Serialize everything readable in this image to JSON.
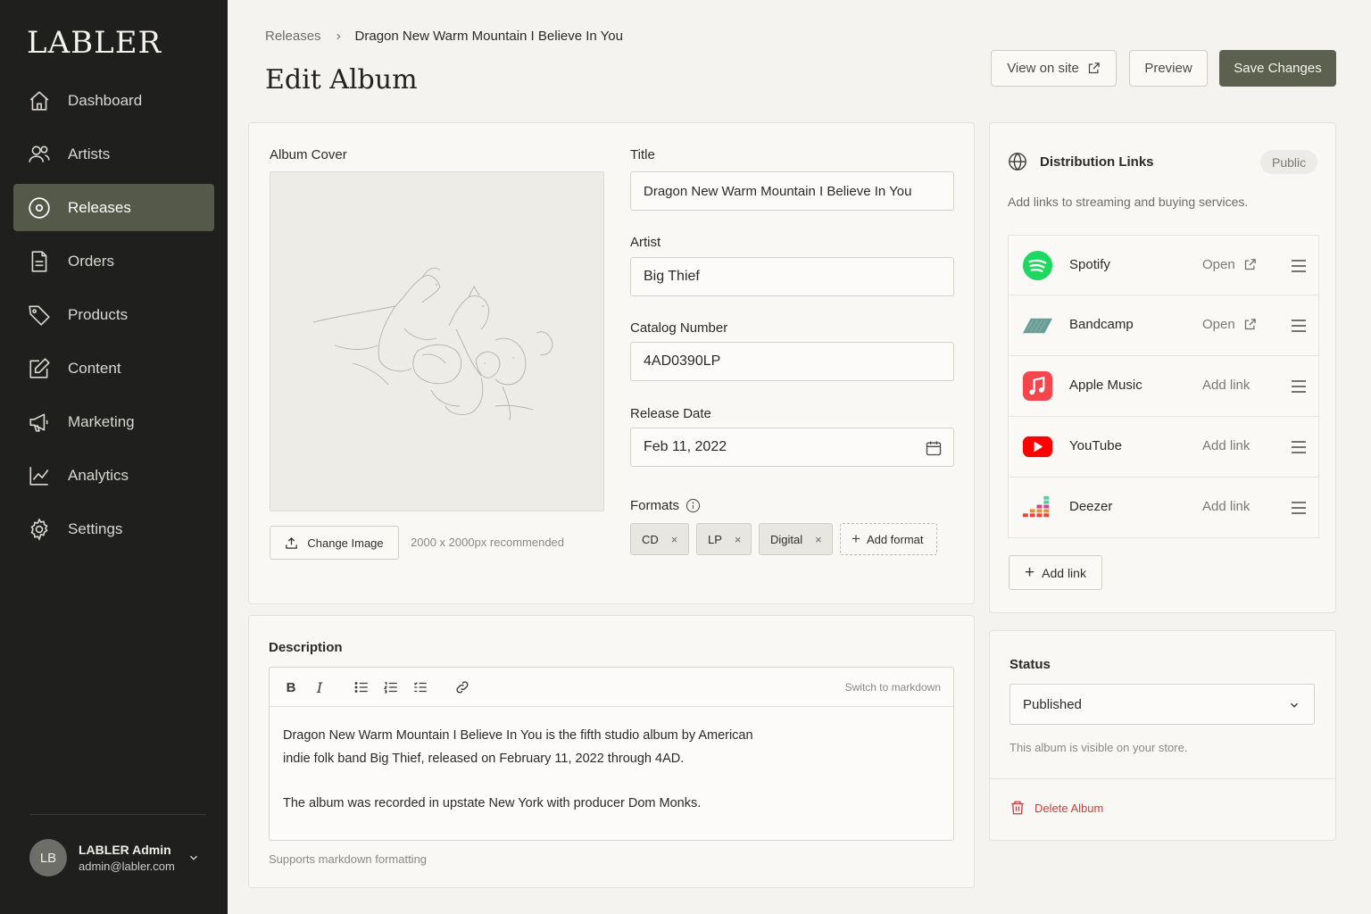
{
  "sidebar": {
    "logo": "LABLER",
    "items": [
      {
        "label": "Dashboard",
        "icon": "home-icon"
      },
      {
        "label": "Artists",
        "icon": "users-icon"
      },
      {
        "label": "Releases",
        "icon": "disc-icon",
        "active": true
      },
      {
        "label": "Orders",
        "icon": "document-icon"
      },
      {
        "label": "Products",
        "icon": "tag-icon"
      },
      {
        "label": "Content",
        "icon": "edit-icon"
      },
      {
        "label": "Marketing",
        "icon": "megaphone-icon"
      },
      {
        "label": "Analytics",
        "icon": "chart-icon"
      },
      {
        "label": "Settings",
        "icon": "gear-icon"
      }
    ],
    "user": {
      "initials": "LB",
      "name": "LABLER Admin",
      "email": "admin@labler.com"
    }
  },
  "header": {
    "breadcrumb_root": "Releases",
    "breadcrumb_current": "Dragon New Warm Mountain I Believe In You",
    "title": "Edit Album",
    "view_on_site": "View on site",
    "preview": "Preview",
    "save": "Save Changes"
  },
  "album": {
    "cover_label": "Album Cover",
    "change_image": "Change Image",
    "cover_hint": "2000 x 2000px recommended",
    "title_label": "Title",
    "title_value": "Dragon New Warm Mountain I Believe In You",
    "artist_label": "Artist",
    "artist_value": "Big Thief",
    "catalog_label": "Catalog Number",
    "catalog_value": "4AD0390LP",
    "release_label": "Release Date",
    "release_value": "Feb 11, 2022",
    "formats_label": "Formats",
    "formats": [
      "CD",
      "LP",
      "Digital"
    ],
    "add_format": "Add format"
  },
  "description": {
    "label": "Description",
    "switch_markdown": "Switch to markdown",
    "paragraph1": "Dragon New Warm Mountain I Believe In You is the fifth studio album by American indie folk band Big Thief, released on February 11, 2022 through 4AD.",
    "paragraph2": "The album was recorded in upstate New York with producer Dom Monks.",
    "hint": "Supports markdown formatting"
  },
  "distribution": {
    "title": "Distribution Links",
    "badge": "Public",
    "subtitle": "Add links to streaming and buying services.",
    "services": [
      {
        "name": "Spotify",
        "action": "Open",
        "color": "#1ed760"
      },
      {
        "name": "Bandcamp",
        "action": "Open",
        "color": "#6a9e95"
      },
      {
        "name": "Apple Music",
        "action": "Add link",
        "color": "#f4464d"
      },
      {
        "name": "YouTube",
        "action": "Add link",
        "color": "#ff0000"
      },
      {
        "name": "Deezer",
        "action": "Add link",
        "color": "#e8443a"
      }
    ],
    "add_link": "Add link"
  },
  "status": {
    "label": "Status",
    "value": "Published",
    "hint": "This album is visible on your store.",
    "delete": "Delete Album"
  },
  "colors": {
    "accent": "#5b604f",
    "sidebar_bg": "#1f1f1e",
    "danger": "#c6423c"
  }
}
